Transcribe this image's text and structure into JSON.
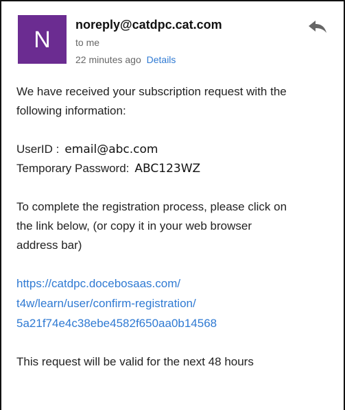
{
  "email": {
    "sender": "noreply@catdpc.cat.com",
    "avatar_initial": "N",
    "recipient": "to me",
    "timestamp": "22 minutes ago",
    "details_label": "Details",
    "reply_icon": "reply-icon",
    "colors": {
      "avatar_bg": "#6b2c91",
      "link": "#2f7ad3"
    }
  },
  "body": {
    "intro_lines": [
      "We have received your subscription request with the",
      "following information:"
    ],
    "user_id_label": "UserID :",
    "user_id_value": "email@abc.com",
    "password_label": "Temporary Password:",
    "password_value": "ABC123WZ",
    "instruction_lines": [
      "To complete the registration process, please click on",
      "the link below, (or copy it in your web browser",
      "address bar)"
    ],
    "link_lines": [
      "https://catdpc.docebosaas.com/",
      "t4w/learn/user/confirm-registration/",
      "5a21f74e4c38ebe4582f650aa0b14568"
    ],
    "validity_text": "This request will be valid for the next 48 hours"
  }
}
